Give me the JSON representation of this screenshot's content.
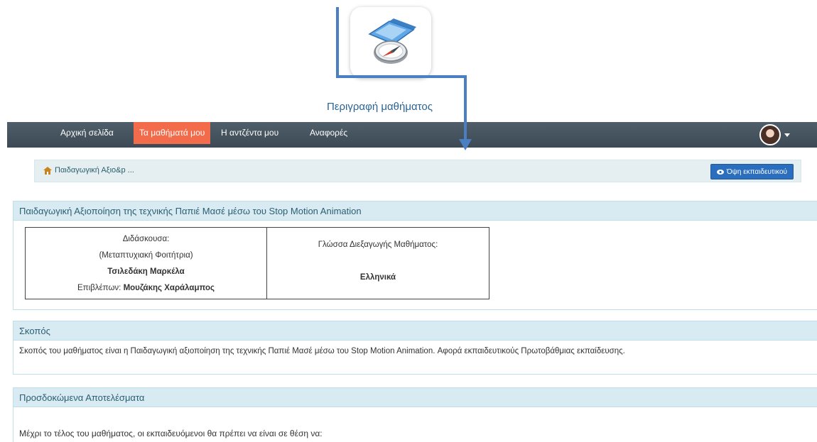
{
  "caption": "Περιγραφή μαθήματος",
  "icons": {
    "course": "compass-map-icon",
    "home": "home-icon",
    "eye": "eye-icon"
  },
  "nav": {
    "items": [
      {
        "label": "Αρχική σελίδα"
      },
      {
        "label": "Τα μαθήματά μου",
        "active": true
      },
      {
        "label": "Η αντζέντα μου"
      },
      {
        "label": "Αναφορές"
      }
    ]
  },
  "breadcrumb": {
    "label": "Παιδαγωγική Αξιο&p ..."
  },
  "teacher_view": {
    "label": "Όψη εκπαιδευτικού"
  },
  "course": {
    "title": "Παιδαγωγική Αξιοποίηση της τεχνικής Παπιέ Μασέ μέσω του Stop Motion Animation",
    "instructor_heading": "Διδάσκουσα:",
    "instructor_role": "(Μεταπτυχιακή Φοιτήτρια)",
    "instructor_name": "Τσιλεδάκη Μαρκέλα",
    "supervisor_label": "Επιβλέπων:",
    "supervisor_name": "Μουζάκης Χαράλαμπος",
    "language_label": "Γλώσσα Διεξαγωγής Μαθήματος:",
    "language_value": "Ελληνικά"
  },
  "goal": {
    "heading": "Σκοπός",
    "text": "Σκοπός του μαθήματος είναι η Παιδαγωγική αξιοποίηση της τεχνικής Παπιέ Μασέ μέσω του Stop Motion Animation. Αφορά εκπαιδευτικούς Πρωτοβάθμιας εκπαίδευσης."
  },
  "outcomes": {
    "heading": "Προσδοκώμενα Αποτελέσματα",
    "text": "Μέχρι το τέλος του μαθήματος,  οι εκπαιδευόμενοι θα πρέπει να είναι σε θέση να:"
  },
  "colors": {
    "nav_bg": "#45525d",
    "nav_active": "#f26b4b",
    "panel_head": "#d8ebf3",
    "button": "#2a6ebd",
    "annotation": "#4a7fc1"
  }
}
